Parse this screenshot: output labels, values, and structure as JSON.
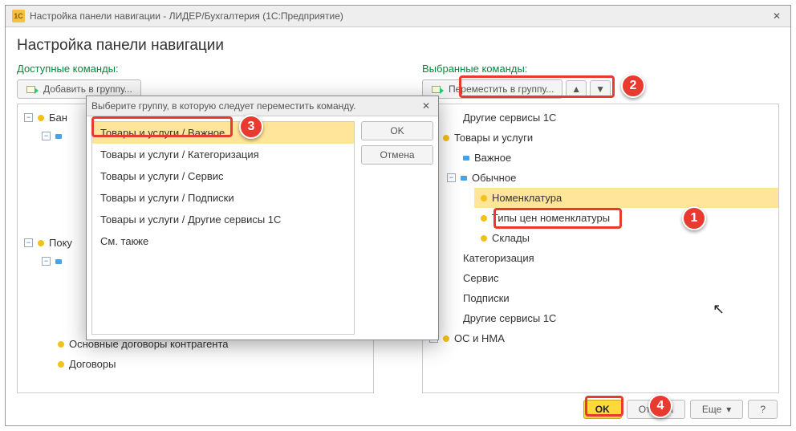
{
  "titlebar": {
    "app_icon": "1C",
    "title": "Настройка панели навигации - ЛИДЕР/Бухгалтерия  (1С:Предприятие)"
  },
  "page_heading": "Настройка панели навигации",
  "left": {
    "label": "Доступные команды:",
    "add_to_group": "Добавить в группу...",
    "tree": {
      "bank": "Бан",
      "contractor_agreements": "Основные договоры контрагента",
      "agreements": "Договоры",
      "pok": "Поку"
    }
  },
  "right": {
    "label": "Выбранные команды:",
    "move_to_group": "Переместить в группу...",
    "tree": {
      "other_services": "Другие сервисы 1С",
      "goods_services": "Товары и услуги",
      "important": "Важное",
      "regular": "Обычное",
      "nomenclature": "Номенклатура",
      "price_types": "Типы цен номенклатуры",
      "warehouses": "Склады",
      "categorization": "Категоризация",
      "service": "Сервис",
      "subscriptions": "Подписки",
      "other_services2": "Другие сервисы 1С",
      "os_nma": "ОС и НМА"
    }
  },
  "mid_buttons": {
    "add": ">",
    "add_all": ">>"
  },
  "popup": {
    "title": "Выберите группу, в которую следует переместить команду.",
    "options": [
      "Товары и услуги / Важное",
      "Товары и услуги / Категоризация",
      "Товары и услуги / Сервис",
      "Товары и услуги / Подписки",
      "Товары и услуги / Другие сервисы 1С",
      "См. также"
    ],
    "ok": "OK",
    "cancel": "Отмена"
  },
  "footer": {
    "ok": "OK",
    "cancel": "Отмена",
    "more": "Еще",
    "help": "?"
  },
  "markers": {
    "m1": "1",
    "m2": "2",
    "m3": "3",
    "m4": "4"
  }
}
